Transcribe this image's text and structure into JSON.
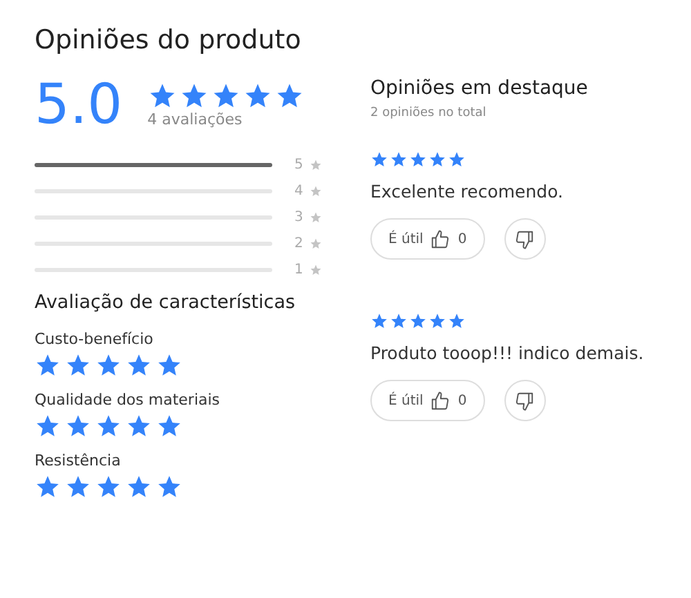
{
  "title": "Opiniões do produto",
  "summary": {
    "average": "5.0",
    "stars": 5,
    "count": "4 avaliações"
  },
  "distribution": [
    {
      "label": "5",
      "level": 1
    },
    {
      "label": "4",
      "level": 0
    },
    {
      "label": "3",
      "level": 0
    },
    {
      "label": "2",
      "level": 0
    },
    {
      "label": "1",
      "level": 0
    }
  ],
  "characteristics": {
    "title": "Avaliação de características",
    "items": [
      {
        "name": "Custo-benefício",
        "stars": 5
      },
      {
        "name": "Qualidade dos materiais",
        "stars": 5
      },
      {
        "name": "Resistência",
        "stars": 5
      }
    ]
  },
  "featured": {
    "title": "Opiniões em destaque",
    "subtitle": "2 opiniões no total",
    "reviews": [
      {
        "stars": 5,
        "text": "Excelente recomendo.",
        "helpful_label": "É útil",
        "likes": "0"
      },
      {
        "stars": 5,
        "text": "Produto tooop!!! indico demais.",
        "helpful_label": "É útil",
        "likes": "0"
      }
    ]
  }
}
